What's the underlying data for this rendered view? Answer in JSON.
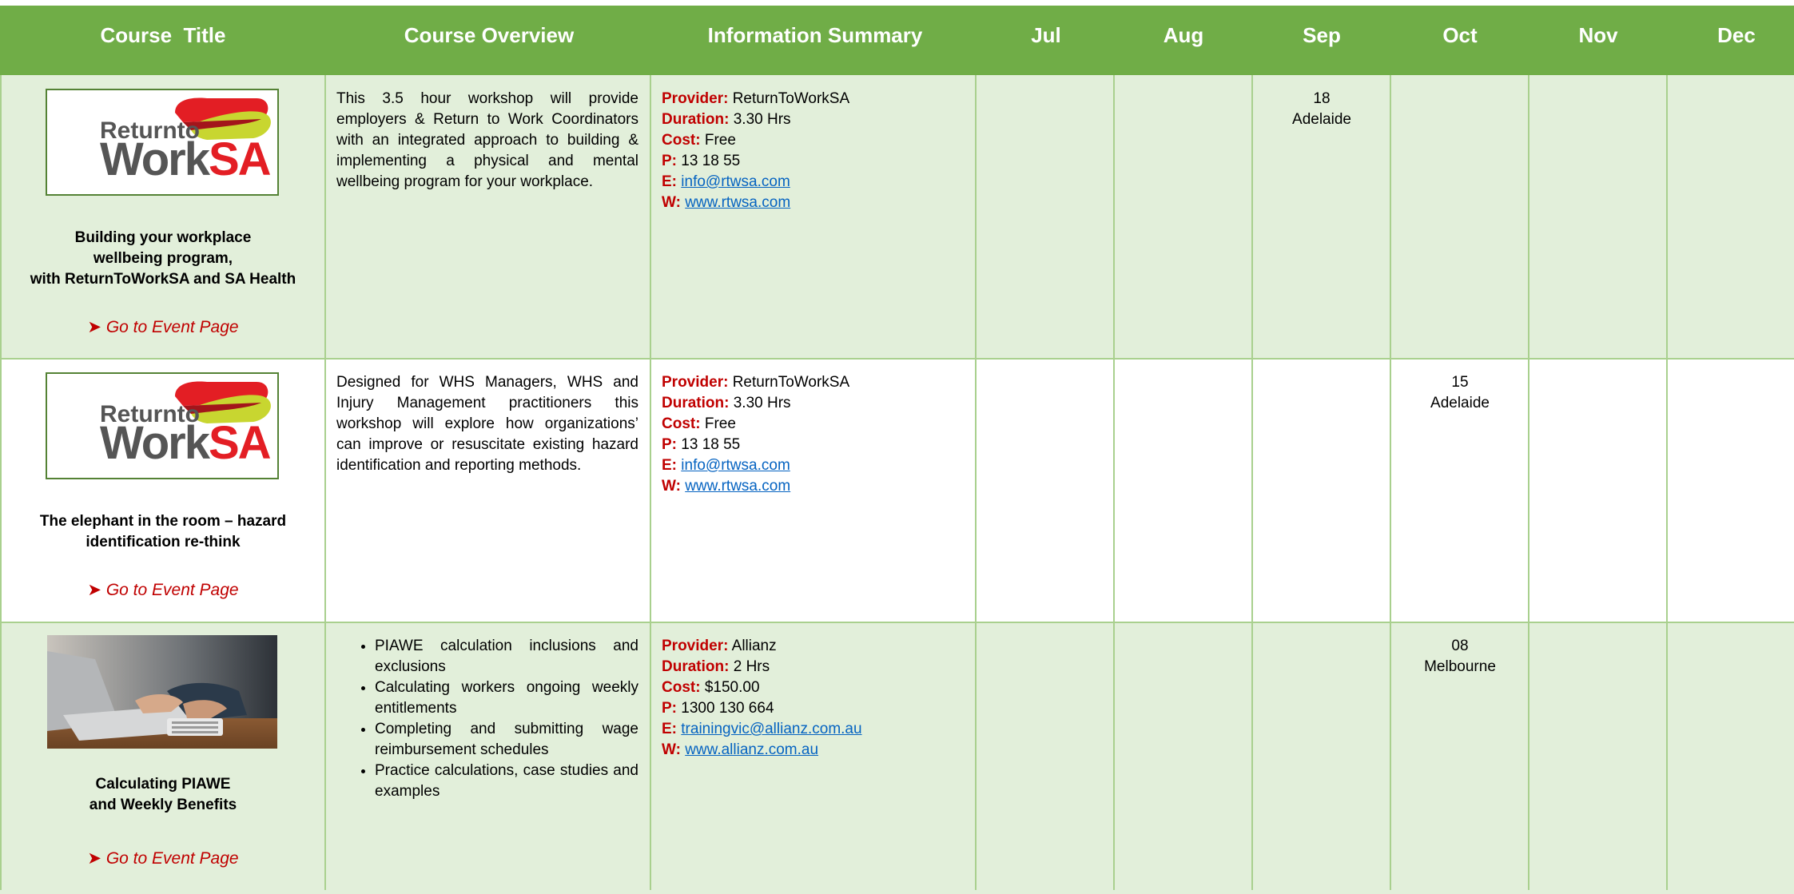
{
  "header": {
    "columns": [
      "Course  Title",
      "Course Overview",
      "Information Summary",
      "Jul",
      "Aug",
      "Sep",
      "Oct",
      "Nov",
      "Dec"
    ]
  },
  "rows": [
    {
      "logo": "ReturnToWorkSA",
      "logo_text": {
        "line1": "Returnto",
        "line2": "WorkSA"
      },
      "title": "Building your workplace\nwellbeing program,\nwith ReturnToWorkSA and SA Health",
      "link": "➤ Go to Event Page",
      "overview": "This 3.5 hour workshop will provide employers & Return to Work Coordinators with an integrated approach to building & implementing a physical and mental wellbeing program for your workplace.",
      "info": {
        "provider_label": "Provider:",
        "provider": "ReturnToWorkSA",
        "duration_label": "Duration:",
        "duration": "3.30 Hrs",
        "cost_label": "Cost:",
        "cost": "Free",
        "phone_label": "P:",
        "phone": "13 18 55",
        "email_label": "E:",
        "email": "info@rtwsa.com",
        "web_label": "W:",
        "web": "www.rtwsa.com"
      },
      "date": {
        "month": "Sep",
        "day": "18",
        "city": "Adelaide"
      }
    },
    {
      "logo": "ReturnToWorkSA",
      "logo_text": {
        "line1": "Returnto",
        "line2": "WorkSA"
      },
      "title": "The elephant in the room – hazard\nidentification re-think",
      "link": "➤ Go to Event Page",
      "overview": "Designed for WHS Managers, WHS and Injury Management practitioners this workshop will explore how organizations’ can improve or resuscitate existing hazard identification and reporting methods.",
      "info": {
        "provider_label": "Provider:",
        "provider": "ReturnToWorkSA",
        "duration_label": "Duration:",
        "duration": "3.30 Hrs",
        "cost_label": "Cost:",
        "cost": "Free",
        "phone_label": "P:",
        "phone": "13 18 55",
        "email_label": "E:",
        "email": "info@rtwsa.com",
        "web_label": "W:",
        "web": "www.rtwsa.com"
      },
      "date": {
        "month": "Oct",
        "day": "15",
        "city": "Adelaide"
      }
    },
    {
      "logo": "laptop-photo",
      "title": "Calculating PIAWE\nand Weekly Benefits",
      "link": "➤ Go to Event Page",
      "overview_bullets": [
        "PIAWE calculation inclusions and exclusions",
        "Calculating workers ongoing weekly entitlements",
        "Completing and submitting wage reimbursement schedules",
        "Practice calculations, case studies and examples"
      ],
      "info": {
        "provider_label": "Provider:",
        "provider": "Allianz",
        "duration_label": "Duration:",
        "duration": "2 Hrs",
        "cost_label": "Cost:",
        "cost": "$150.00",
        "phone_label": "P:",
        "phone": "1300 130 664",
        "email_label": "E:",
        "email": "trainingvic@allianz.com.au",
        "web_label": "W:",
        "web": "www.allianz.com.au"
      },
      "date": {
        "month": "Oct",
        "day": "08",
        "city": "Melbourne"
      }
    }
  ],
  "colors": {
    "header_bg": "#70ad47",
    "row_green": "#e2efda",
    "grid": "#a9d08e",
    "label_red": "#c00000",
    "link_blue": "#0563c1"
  }
}
